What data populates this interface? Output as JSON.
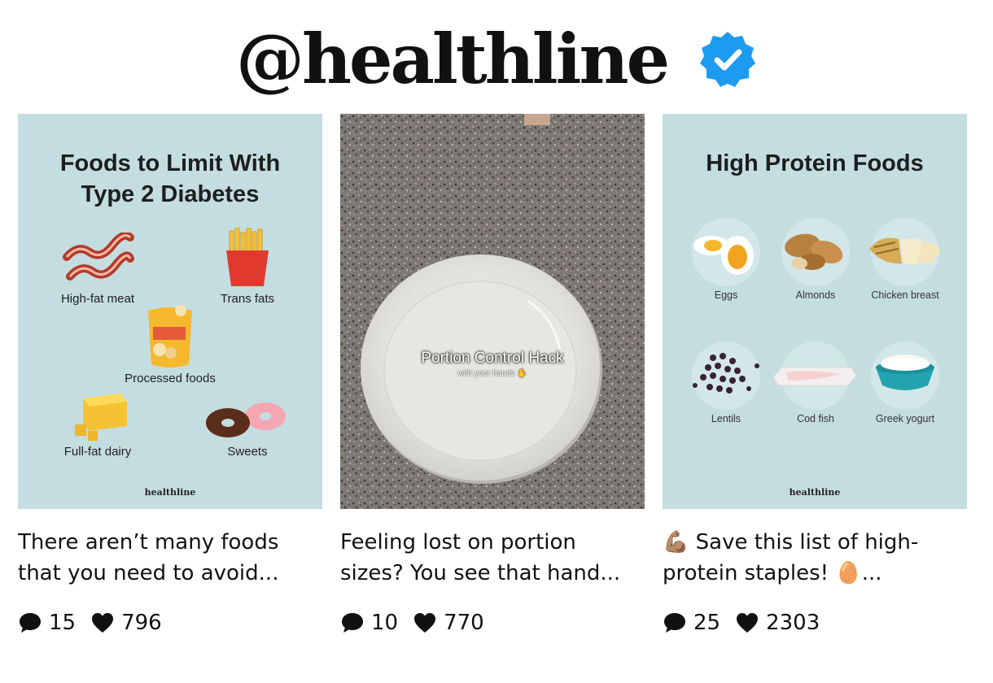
{
  "profile": {
    "handle": "@healthline",
    "verified_icon": "verified-badge-icon",
    "accent": "#1d9bf0"
  },
  "posts": [
    {
      "thumbnail": {
        "title_line1": "Foods to Limit With",
        "title_line2": "Type 2 Diabetes",
        "items": [
          "High-fat meat",
          "Trans fats",
          "Processed foods",
          "Full-fat dairy",
          "Sweets"
        ],
        "brand": "healthline",
        "background": "#c4dde0"
      },
      "caption": "There aren’t many foods that you need to avoid...",
      "comments": "15",
      "likes": "796"
    },
    {
      "thumbnail": {
        "overlay_title": "Portion Control Hack",
        "overlay_subtitle": "with your hands ✋"
      },
      "caption": "Feeling lost on portion sizes? You see that hand...",
      "comments": "10",
      "likes": "770"
    },
    {
      "thumbnail": {
        "title": "High Protein Foods",
        "items": [
          "Eggs",
          "Almonds",
          "Chicken breast",
          "Lentils",
          "Cod fish",
          "Greek yogurt"
        ],
        "brand": "healthline",
        "background": "#c4dde0"
      },
      "caption": "💪🏽 Save this list of high-protein staples! 🥚...",
      "comments": "25",
      "likes": "2303"
    }
  ],
  "icons": {
    "comment": "comment-bubble-icon",
    "like": "heart-icon"
  }
}
